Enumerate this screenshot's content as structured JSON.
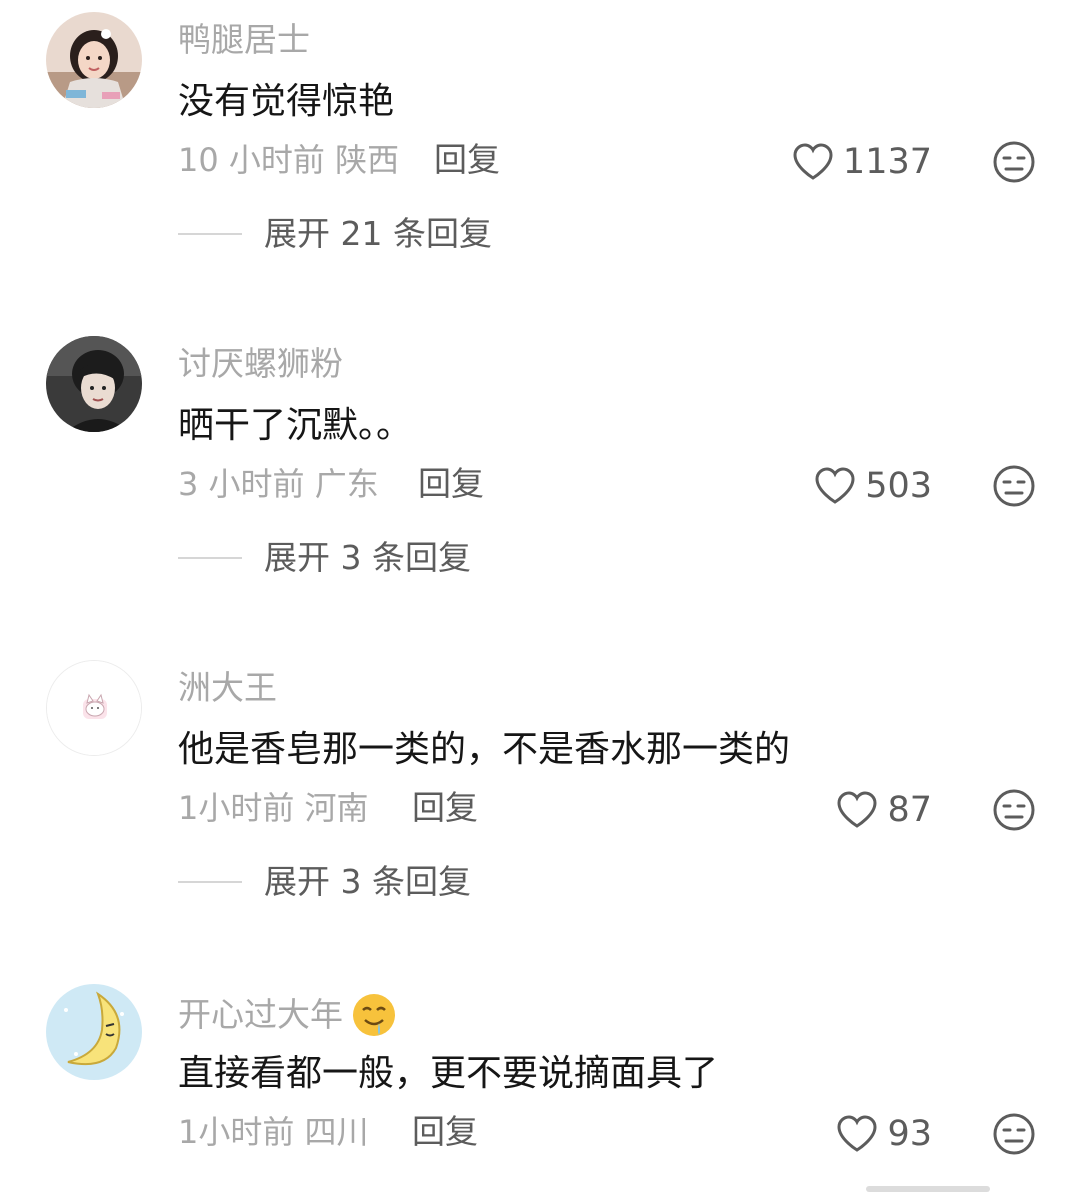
{
  "comments": [
    {
      "username": "鸭腿居士",
      "content": "没有觉得惊艳",
      "meta": "10 小时前 陕西",
      "reply_label": "回复",
      "likes": "1137",
      "expand": "展开 21 条回复",
      "avatar_icon": "girl-photo-avatar"
    },
    {
      "username": "讨厌螺狮粉",
      "content": "晒干了沉默。。",
      "meta": "3 小时前 广东",
      "reply_label": "回复",
      "likes": "503",
      "expand": "展开 3 条回复",
      "avatar_icon": "man-photo-avatar"
    },
    {
      "username": "洲大王",
      "content": "他是香皂那一类的，不是香水那一类的",
      "meta": "1小时前 河南",
      "reply_label": "回复",
      "likes": "87",
      "expand": "展开 3 条回复",
      "avatar_icon": "cat-avatar"
    },
    {
      "username": "开心过大年",
      "username_emoji": "drooling-face-emoji",
      "content": "直接看都一般，更不要说摘面具了",
      "meta": "1小时前 四川",
      "reply_label": "回复",
      "likes": "93",
      "avatar_icon": "moon-avatar"
    }
  ],
  "colors": {
    "username": "#a8a8a8",
    "content": "#161616",
    "secondary": "#5c5c5c",
    "divider": "#d6d6d6"
  }
}
